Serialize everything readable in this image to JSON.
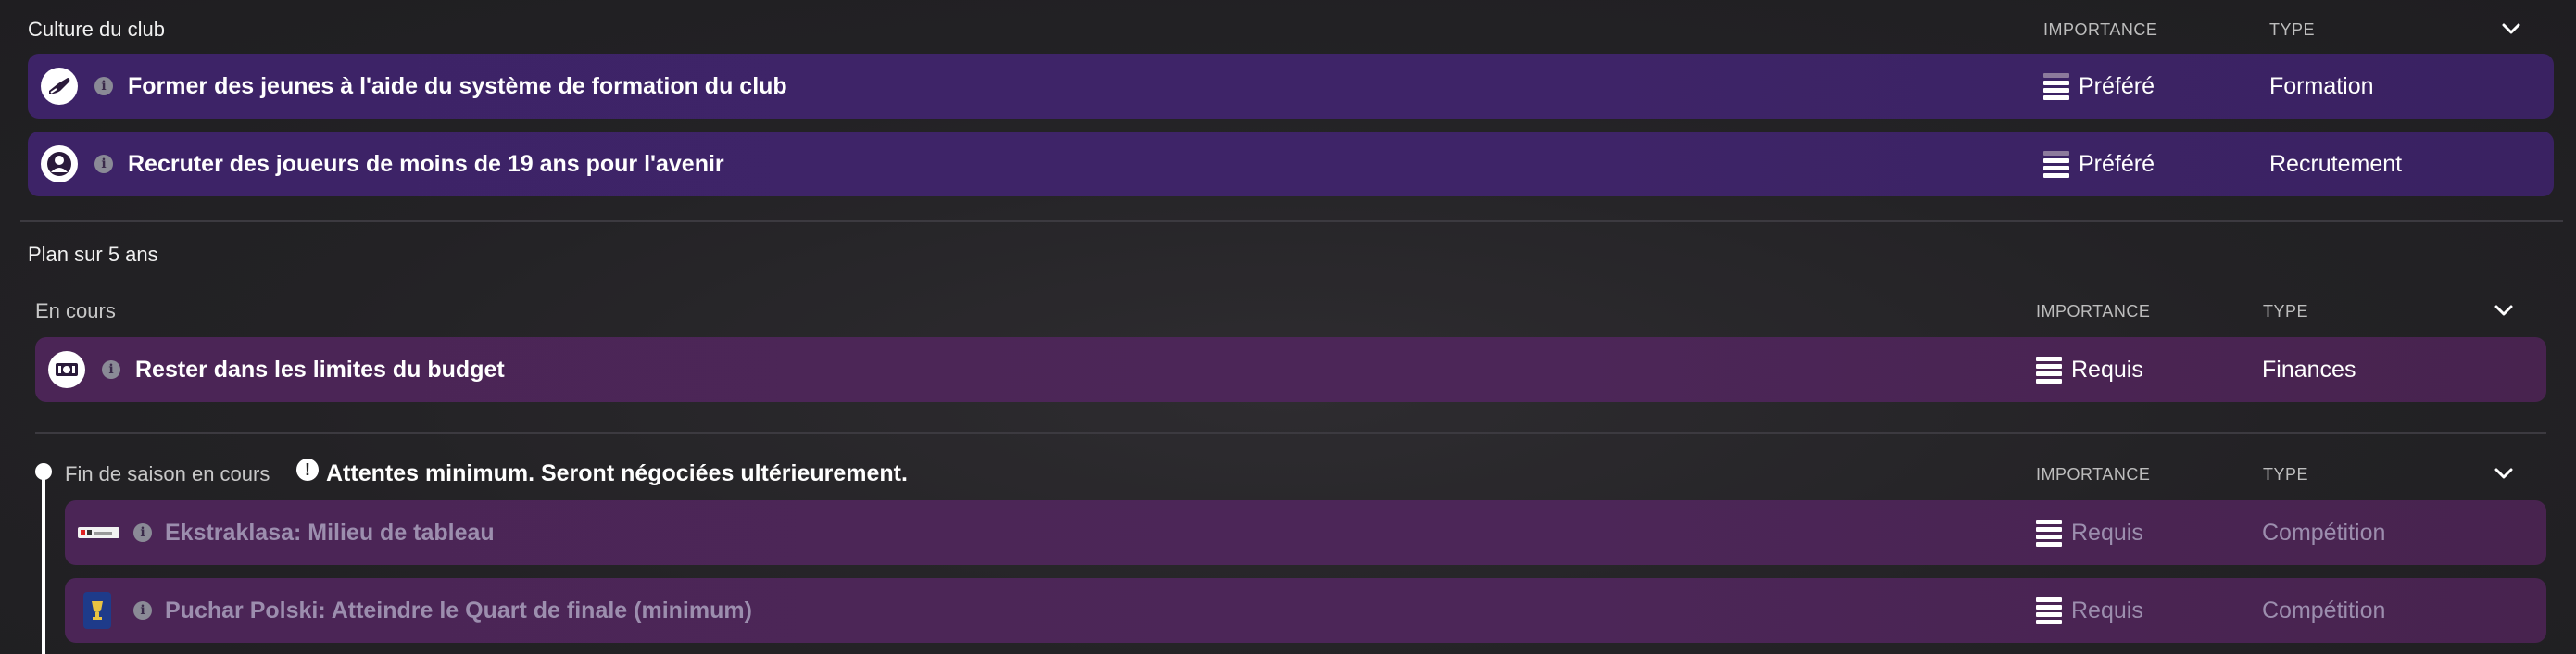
{
  "culture": {
    "title": "Culture du club",
    "col_importance": "IMPORTANCE",
    "col_type": "TYPE",
    "rows": [
      {
        "text": "Former des jeunes à l'aide du système de formation du club",
        "importance": "Préféré",
        "type": "Formation",
        "icon": "boot-icon",
        "level": 3
      },
      {
        "text": "Recruter des joueurs de moins de 19 ans pour l'avenir",
        "importance": "Préféré",
        "type": "Recrutement",
        "icon": "person-icon",
        "level": 3
      }
    ]
  },
  "plan": {
    "title": "Plan sur 5 ans",
    "in_progress": {
      "label": "En cours",
      "col_importance": "IMPORTANCE",
      "col_type": "TYPE",
      "rows": [
        {
          "text": "Rester dans les limites du budget",
          "importance": "Requis",
          "type": "Finances",
          "icon": "money-icon",
          "level": 4
        }
      ]
    },
    "season_end": {
      "label": "Fin de saison en cours",
      "warning": "Attentes minimum. Seront négociées ultérieurement.",
      "col_importance": "IMPORTANCE",
      "col_type": "TYPE",
      "rows": [
        {
          "text": "Ekstraklasa: Milieu de tableau",
          "importance": "Requis",
          "type": "Compétition",
          "icon": "ekstraklasa-logo-icon",
          "level": 4
        },
        {
          "text": "Puchar Polski: Atteindre le Quart de finale (minimum)",
          "importance": "Requis",
          "type": "Compétition",
          "icon": "puchar-polski-logo-icon",
          "level": 4
        }
      ]
    }
  },
  "colors": {
    "row_purple": "#3d2367",
    "row_magenta": "#4b2556",
    "dim_text": "#9c8eae"
  }
}
